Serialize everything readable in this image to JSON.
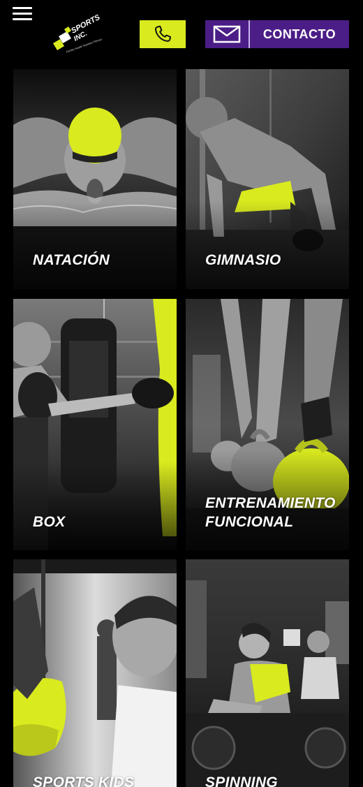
{
  "header": {
    "menu_icon": "hamburger-menu-icon",
    "logo": {
      "line1": "SPORTS",
      "line2": "INC.",
      "tagline": "Family Health Nutrition Fitness"
    },
    "phone_icon": "phone-icon",
    "contact": {
      "icon": "mail-icon",
      "label": "CONTACTO"
    }
  },
  "colors": {
    "accent": "#d9ea1f",
    "purple": "#4b1d86",
    "background": "#000000"
  },
  "tiles": [
    {
      "label": "NATACIÓN"
    },
    {
      "label": "GIMNASIO"
    },
    {
      "label": "BOX"
    },
    {
      "label_line1": "ENTRENAMIENTO",
      "label_line2": "FUNCIONAL"
    },
    {
      "label": "SPORTS KIDS"
    },
    {
      "label": "SPINNING"
    }
  ]
}
